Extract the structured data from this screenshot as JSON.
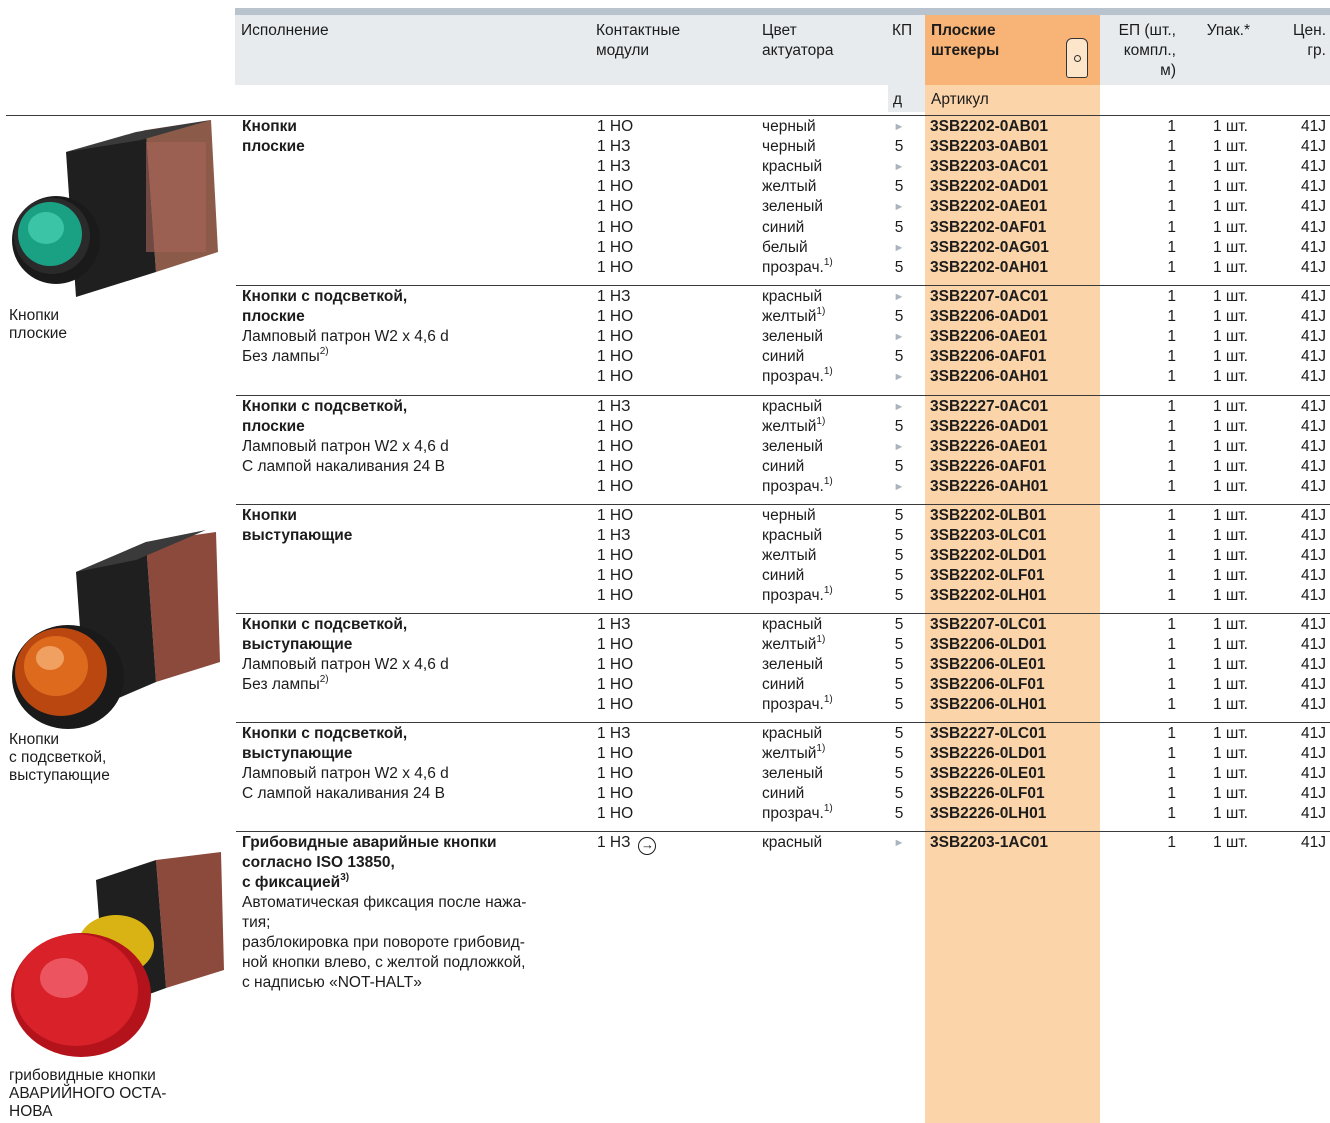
{
  "headers": {
    "execution": "Исполнение",
    "contact_modules": [
      "Контактные",
      "модули"
    ],
    "actuator_color": [
      "Цвет",
      "актуатора"
    ],
    "kp": "КП",
    "kp_sub": "д",
    "flat_plugs": [
      "Плоские",
      "штекеры"
    ],
    "article": "Артикул",
    "ep": [
      "ЕП (шт.,",
      "компл.,",
      "м)"
    ],
    "pack": "Упак.*",
    "price_group": [
      "Цен.",
      "гр."
    ]
  },
  "image_labels": [
    [
      "Кнопки",
      "плоские"
    ],
    [
      "Кнопки",
      "с подсветкой,",
      "выступающие"
    ],
    [
      "грибовидные кнопки",
      "АВАРИЙНОГО ОСТА-",
      "НОВА"
    ]
  ],
  "groups": [
    {
      "title": [
        "Кнопки",
        "плоские"
      ],
      "details": [],
      "rows": [
        {
          "contact": "1 НО",
          "color": "черный",
          "sup": "",
          "kp": "►",
          "article": "3SB2202-0AB01",
          "ep": "1",
          "pack": "1 шт.",
          "price": "41J"
        },
        {
          "contact": "1 НЗ",
          "color": "черный",
          "sup": "",
          "kp": "5",
          "article": "3SB2203-0AB01",
          "ep": "1",
          "pack": "1 шт.",
          "price": "41J"
        },
        {
          "contact": "1 НЗ",
          "color": "красный",
          "sup": "",
          "kp": "►",
          "article": "3SB2203-0AC01",
          "ep": "1",
          "pack": "1 шт.",
          "price": "41J"
        },
        {
          "contact": "1 НО",
          "color": "желтый",
          "sup": "",
          "kp": "5",
          "article": "3SB2202-0AD01",
          "ep": "1",
          "pack": "1 шт.",
          "price": "41J"
        },
        {
          "contact": "1 НО",
          "color": "зеленый",
          "sup": "",
          "kp": "►",
          "article": "3SB2202-0AE01",
          "ep": "1",
          "pack": "1 шт.",
          "price": "41J"
        },
        {
          "contact": "1 НО",
          "color": "синий",
          "sup": "",
          "kp": "5",
          "article": "3SB2202-0AF01",
          "ep": "1",
          "pack": "1 шт.",
          "price": "41J"
        },
        {
          "contact": "1 НО",
          "color": "белый",
          "sup": "",
          "kp": "►",
          "article": "3SB2202-0AG01",
          "ep": "1",
          "pack": "1 шт.",
          "price": "41J"
        },
        {
          "contact": "1 НО",
          "color": "прозрач.",
          "sup": "1)",
          "kp": "5",
          "article": "3SB2202-0AH01",
          "ep": "1",
          "pack": "1 шт.",
          "price": "41J"
        }
      ]
    },
    {
      "title": [
        "Кнопки с подсветкой,",
        "плоские"
      ],
      "details": [
        "Ламповый патрон W2 x 4,6 d",
        "Без лампы|2)"
      ],
      "rows": [
        {
          "contact": "1 НЗ",
          "color": "красный",
          "sup": "",
          "kp": "►",
          "article": "3SB2207-0AC01",
          "ep": "1",
          "pack": "1 шт.",
          "price": "41J"
        },
        {
          "contact": "1 НО",
          "color": "желтый",
          "sup": "1)",
          "kp": "5",
          "article": "3SB2206-0AD01",
          "ep": "1",
          "pack": "1 шт.",
          "price": "41J"
        },
        {
          "contact": "1 НО",
          "color": "зеленый",
          "sup": "",
          "kp": "►",
          "article": "3SB2206-0AE01",
          "ep": "1",
          "pack": "1 шт.",
          "price": "41J"
        },
        {
          "contact": "1 НО",
          "color": "синий",
          "sup": "",
          "kp": "5",
          "article": "3SB2206-0AF01",
          "ep": "1",
          "pack": "1 шт.",
          "price": "41J"
        },
        {
          "contact": "1 НО",
          "color": "прозрач.",
          "sup": "1)",
          "kp": "►",
          "article": "3SB2206-0AH01",
          "ep": "1",
          "pack": "1 шт.",
          "price": "41J"
        }
      ]
    },
    {
      "title": [
        "Кнопки с подсветкой,",
        "плоские"
      ],
      "details": [
        "Ламповый патрон W2 x 4,6 d",
        "С лампой накаливания 24 В"
      ],
      "rows": [
        {
          "contact": "1 НЗ",
          "color": "красный",
          "sup": "",
          "kp": "►",
          "article": "3SB2227-0AC01",
          "ep": "1",
          "pack": "1 шт.",
          "price": "41J"
        },
        {
          "contact": "1 НО",
          "color": "желтый",
          "sup": "1)",
          "kp": "5",
          "article": "3SB2226-0AD01",
          "ep": "1",
          "pack": "1 шт.",
          "price": "41J"
        },
        {
          "contact": "1 НО",
          "color": "зеленый",
          "sup": "",
          "kp": "►",
          "article": "3SB2226-0AE01",
          "ep": "1",
          "pack": "1 шт.",
          "price": "41J"
        },
        {
          "contact": "1 НО",
          "color": "синий",
          "sup": "",
          "kp": "5",
          "article": "3SB2226-0AF01",
          "ep": "1",
          "pack": "1 шт.",
          "price": "41J"
        },
        {
          "contact": "1 НО",
          "color": "прозрач.",
          "sup": "1)",
          "kp": "►",
          "article": "3SB2226-0AH01",
          "ep": "1",
          "pack": "1 шт.",
          "price": "41J"
        }
      ]
    },
    {
      "title": [
        "Кнопки",
        "выступающие"
      ],
      "details": [],
      "rows": [
        {
          "contact": "1 НО",
          "color": "черный",
          "sup": "",
          "kp": "5",
          "article": "3SB2202-0LB01",
          "ep": "1",
          "pack": "1 шт.",
          "price": "41J"
        },
        {
          "contact": "1 НЗ",
          "color": "красный",
          "sup": "",
          "kp": "5",
          "article": "3SB2203-0LC01",
          "ep": "1",
          "pack": "1 шт.",
          "price": "41J"
        },
        {
          "contact": "1 НО",
          "color": "желтый",
          "sup": "",
          "kp": "5",
          "article": "3SB2202-0LD01",
          "ep": "1",
          "pack": "1 шт.",
          "price": "41J"
        },
        {
          "contact": "1 НО",
          "color": "синий",
          "sup": "",
          "kp": "5",
          "article": "3SB2202-0LF01",
          "ep": "1",
          "pack": "1 шт.",
          "price": "41J"
        },
        {
          "contact": "1 НО",
          "color": "прозрач.",
          "sup": "1)",
          "kp": "5",
          "article": "3SB2202-0LH01",
          "ep": "1",
          "pack": "1 шт.",
          "price": "41J"
        }
      ]
    },
    {
      "title": [
        "Кнопки с подсветкой,",
        "выступающие"
      ],
      "details": [
        "Ламповый патрон W2 x 4,6 d",
        "Без лампы|2)"
      ],
      "rows": [
        {
          "contact": "1 НЗ",
          "color": "красный",
          "sup": "",
          "kp": "5",
          "article": "3SB2207-0LC01",
          "ep": "1",
          "pack": "1 шт.",
          "price": "41J"
        },
        {
          "contact": "1 НО",
          "color": "желтый",
          "sup": "1)",
          "kp": "5",
          "article": "3SB2206-0LD01",
          "ep": "1",
          "pack": "1 шт.",
          "price": "41J"
        },
        {
          "contact": "1 НО",
          "color": "зеленый",
          "sup": "",
          "kp": "5",
          "article": "3SB2206-0LE01",
          "ep": "1",
          "pack": "1 шт.",
          "price": "41J"
        },
        {
          "contact": "1 НО",
          "color": "синий",
          "sup": "",
          "kp": "5",
          "article": "3SB2206-0LF01",
          "ep": "1",
          "pack": "1 шт.",
          "price": "41J"
        },
        {
          "contact": "1 НО",
          "color": "прозрач.",
          "sup": "1)",
          "kp": "5",
          "article": "3SB2206-0LH01",
          "ep": "1",
          "pack": "1 шт.",
          "price": "41J"
        }
      ]
    },
    {
      "title": [
        "Кнопки с подсветкой,",
        "выступающие"
      ],
      "details": [
        "Ламповый патрон W2 x 4,6 d",
        "С лампой накаливания 24 В"
      ],
      "rows": [
        {
          "contact": "1 НЗ",
          "color": "красный",
          "sup": "",
          "kp": "5",
          "article": "3SB2227-0LC01",
          "ep": "1",
          "pack": "1 шт.",
          "price": "41J"
        },
        {
          "contact": "1 НО",
          "color": "желтый",
          "sup": "1)",
          "kp": "5",
          "article": "3SB2226-0LD01",
          "ep": "1",
          "pack": "1 шт.",
          "price": "41J"
        },
        {
          "contact": "1 НО",
          "color": "зеленый",
          "sup": "",
          "kp": "5",
          "article": "3SB2226-0LE01",
          "ep": "1",
          "pack": "1 шт.",
          "price": "41J"
        },
        {
          "contact": "1 НО",
          "color": "синий",
          "sup": "",
          "kp": "5",
          "article": "3SB2226-0LF01",
          "ep": "1",
          "pack": "1 шт.",
          "price": "41J"
        },
        {
          "contact": "1 НО",
          "color": "прозрач.",
          "sup": "1)",
          "kp": "5",
          "article": "3SB2226-0LH01",
          "ep": "1",
          "pack": "1 шт.",
          "price": "41J"
        }
      ]
    },
    {
      "title": [
        "Грибовидные аварийные кнопки",
        "согласно ISO 13850,",
        "с фиксацией|3)"
      ],
      "details": [
        "Автоматическая фиксация после нажа-",
        "тия;",
        "разблокировка при повороте грибовид-",
        "ной кнопки влево, с желтой подложкой,",
        "с надписью «NOT-HALT»"
      ],
      "rows": [
        {
          "contact": "1 НЗ",
          "color": "красный",
          "sup": "",
          "kp": "►",
          "article": "3SB2203-1AC01",
          "ep": "1",
          "pack": "1 шт.",
          "price": "41J",
          "icon": "forced-opening-icon"
        }
      ]
    }
  ],
  "colors": {
    "accent_orange": "#fcd4a9",
    "header_orange": "#f8b477",
    "header_gray": "#e7ebee",
    "kp_triangle": "#a9b4be"
  }
}
